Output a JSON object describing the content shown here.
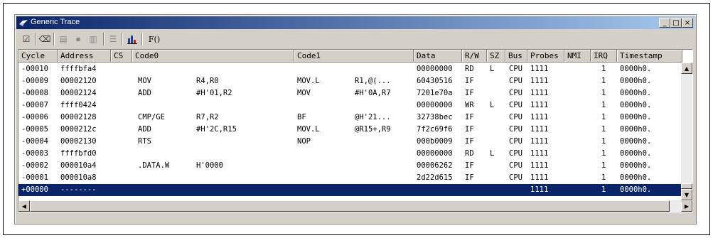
{
  "window": {
    "title": "Generic Trace",
    "icons": [
      "app-icon",
      "minimize-icon",
      "maximize-icon",
      "close-icon"
    ],
    "buttons": {
      "minimize": "_",
      "maximize": "□",
      "close": "×"
    }
  },
  "toolbar": {
    "items": [
      {
        "name": "properties-icon",
        "glyph": "☑"
      },
      {
        "name": "clear-icon",
        "glyph": "⌫"
      },
      {
        "name": "start-icon",
        "glyph": "▤"
      },
      {
        "name": "stop-icon",
        "glyph": "⏹"
      },
      {
        "name": "step-icon",
        "glyph": "▥"
      },
      {
        "name": "list-icon",
        "glyph": "☰"
      },
      {
        "name": "chart-icon",
        "glyph": "📊"
      },
      {
        "name": "function-icon",
        "glyph": "F()"
      }
    ]
  },
  "table": {
    "columns": [
      "Cycle",
      "Address",
      "CS",
      "Code0",
      "",
      "Code1",
      "",
      "Data",
      "R/W",
      "SZ",
      "Bus",
      "Probes",
      "NMI",
      "IRQ",
      "Timestamp"
    ],
    "rows": [
      {
        "cycle": "-00010",
        "address": "ffffbfa4",
        "cs": "",
        "op0": "",
        "arg0": "",
        "op1": "",
        "arg1": "",
        "data": "00000000",
        "rw": "RD",
        "sz": "L",
        "bus": "CPU",
        "probes": "1111",
        "nmi": "",
        "irq": "1",
        "ts": "0000h0."
      },
      {
        "cycle": "-00009",
        "address": "00002120",
        "cs": "",
        "op0": "MOV",
        "arg0": "R4,R0",
        "op1": "MOV.L",
        "arg1": "R1,@(...",
        "data": "60430516",
        "rw": "IF",
        "sz": "",
        "bus": "CPU",
        "probes": "1111",
        "nmi": "",
        "irq": "1",
        "ts": "0000h0."
      },
      {
        "cycle": "-00008",
        "address": "00002124",
        "cs": "",
        "op0": "ADD",
        "arg0": "#H'01,R2",
        "op1": "MOV",
        "arg1": "#H'0A,R7",
        "data": "7201e70a",
        "rw": "IF",
        "sz": "",
        "bus": "CPU",
        "probes": "1111",
        "nmi": "",
        "irq": "1",
        "ts": "0000h0."
      },
      {
        "cycle": "-00007",
        "address": "ffff0424",
        "cs": "",
        "op0": "",
        "arg0": "",
        "op1": "",
        "arg1": "",
        "data": "00000000",
        "rw": "WR",
        "sz": "L",
        "bus": "CPU",
        "probes": "1111",
        "nmi": "",
        "irq": "1",
        "ts": "0000h0."
      },
      {
        "cycle": "-00006",
        "address": "00002128",
        "cs": "",
        "op0": "CMP/GE",
        "arg0": "R7,R2",
        "op1": "BF",
        "arg1": "@H'21...",
        "data": "32738bec",
        "rw": "IF",
        "sz": "",
        "bus": "CPU",
        "probes": "1111",
        "nmi": "",
        "irq": "1",
        "ts": "0000h0."
      },
      {
        "cycle": "-00005",
        "address": "0000212c",
        "cs": "",
        "op0": "ADD",
        "arg0": "#H'2C,R15",
        "op1": "MOV.L",
        "arg1": "@R15+,R9",
        "data": "7f2c69f6",
        "rw": "IF",
        "sz": "",
        "bus": "CPU",
        "probes": "1111",
        "nmi": "",
        "irq": "1",
        "ts": "0000h0."
      },
      {
        "cycle": "-00004",
        "address": "00002130",
        "cs": "",
        "op0": "RTS",
        "arg0": "",
        "op1": "NOP",
        "arg1": "",
        "data": "000b0009",
        "rw": "IF",
        "sz": "",
        "bus": "CPU",
        "probes": "1111",
        "nmi": "",
        "irq": "1",
        "ts": "0000h0."
      },
      {
        "cycle": "-00003",
        "address": "ffffbfd0",
        "cs": "",
        "op0": "",
        "arg0": "",
        "op1": "",
        "arg1": "",
        "data": "00000000",
        "rw": "RD",
        "sz": "L",
        "bus": "CPU",
        "probes": "1111",
        "nmi": "",
        "irq": "1",
        "ts": "0000h0."
      },
      {
        "cycle": "-00002",
        "address": "000010a4",
        "cs": "",
        "op0": ".DATA.W",
        "arg0": "H'0000",
        "op1": "",
        "arg1": "",
        "data": "00006262",
        "rw": "IF",
        "sz": "",
        "bus": "CPU",
        "probes": "1111",
        "nmi": "",
        "irq": "1",
        "ts": "0000h0."
      },
      {
        "cycle": "-00001",
        "address": "000010a8",
        "cs": "",
        "op0": "",
        "arg0": "",
        "op1": "",
        "arg1": "",
        "data": "2d22d615",
        "rw": "IF",
        "sz": "",
        "bus": "CPU",
        "probes": "1111",
        "nmi": "",
        "irq": "1",
        "ts": "0000h0."
      },
      {
        "cycle": "+00000",
        "address": "--------",
        "cs": "",
        "op0": "",
        "arg0": "",
        "op1": "",
        "arg1": "",
        "data": "",
        "rw": "",
        "sz": "",
        "bus": "",
        "probes": "1111",
        "nmi": "",
        "irq": "1",
        "ts": "0000h0."
      }
    ],
    "selected_row": 10
  },
  "scrollbars": {
    "up": "▲",
    "down": "▼",
    "left": "◀",
    "right": "▶"
  },
  "colors": {
    "title_start": "#0a246a",
    "title_end": "#a6caf0",
    "selection": "#0a246a",
    "face": "#d4d0c8"
  }
}
